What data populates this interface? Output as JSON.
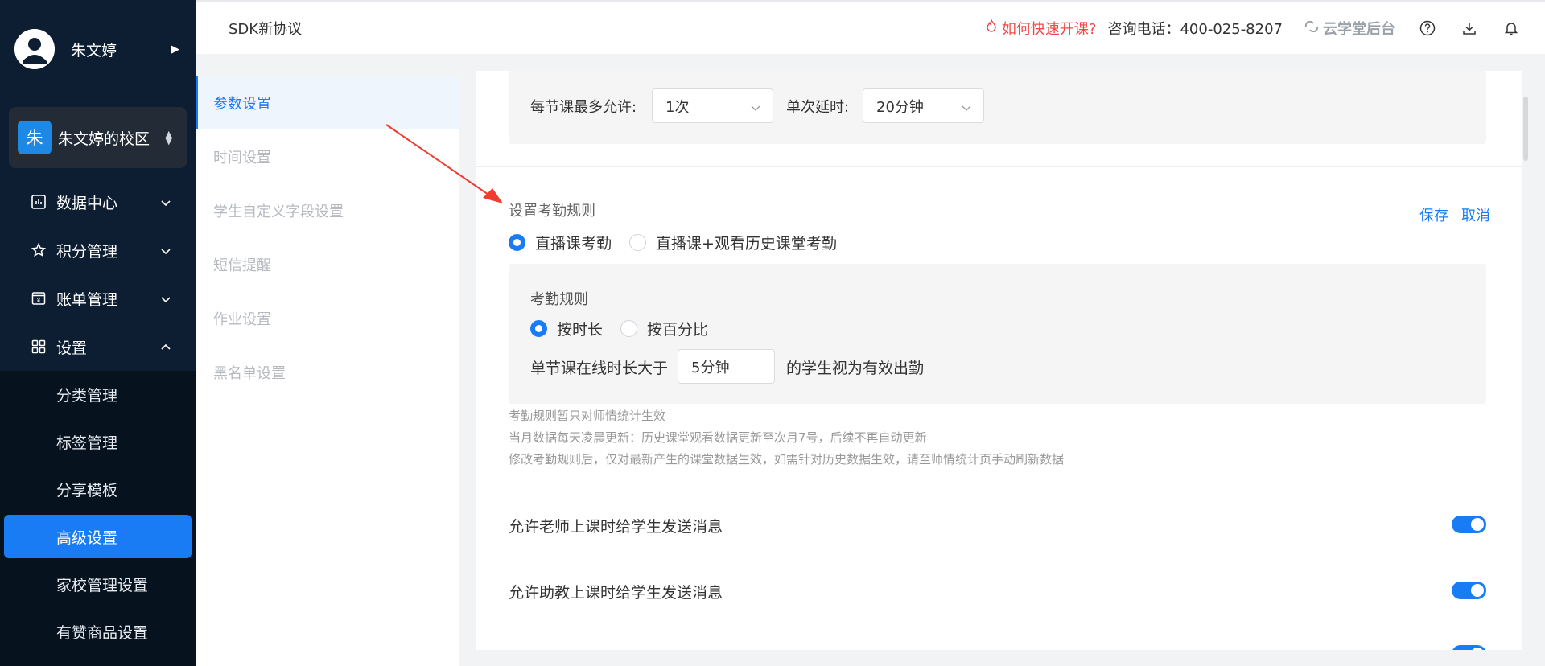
{
  "user": {
    "name": "朱文婷"
  },
  "campus": {
    "badge": "朱",
    "name": "朱文婷的校区"
  },
  "menu": [
    {
      "label": "数据中心",
      "icon": "chart-icon"
    },
    {
      "label": "积分管理",
      "icon": "star-icon"
    },
    {
      "label": "账单管理",
      "icon": "bill-icon"
    },
    {
      "label": "设置",
      "icon": "grid-icon"
    }
  ],
  "submenu": [
    {
      "label": "分类管理"
    },
    {
      "label": "标签管理"
    },
    {
      "label": "分享模板"
    },
    {
      "label": "高级设置",
      "active": true
    },
    {
      "label": "家校管理设置"
    },
    {
      "label": "有赞商品设置"
    }
  ],
  "header": {
    "title": "SDK新协议",
    "quick_start": "如何快速开课?",
    "phone": "咨询电话：400-025-8207",
    "backend": "云学堂后台"
  },
  "subnav": [
    {
      "label": "参数设置",
      "active": true
    },
    {
      "label": "时间设置"
    },
    {
      "label": "学生自定义字段设置"
    },
    {
      "label": "短信提醒"
    },
    {
      "label": "作业设置"
    },
    {
      "label": "黑名单设置"
    }
  ],
  "delay": {
    "max_label": "每节课最多允许:",
    "max_value": "1次",
    "single_label": "单次延时:",
    "single_value": "20分钟"
  },
  "attendance": {
    "title": "设置考勤规则",
    "save": "保存",
    "cancel": "取消",
    "mode_options": [
      "直播课考勤",
      "直播课+观看历史课堂考勤"
    ],
    "mode_selected": 0,
    "rule_title": "考勤规则",
    "rule_options": [
      "按时长",
      "按百分比"
    ],
    "rule_selected": 0,
    "duration_prefix": "单节课在线时长大于",
    "duration_value": "5分钟",
    "duration_suffix": "的学生视为有效出勤",
    "notes": [
      "考勤规则暂只对师情统计生效",
      "当月数据每天凌晨更新：历史课堂观看数据更新至次月7号，后续不再自动更新",
      "修改考勤规则后，仅对最新产生的课堂数据生效，如需针对历史数据生效，请至师情统计页手动刷新数据"
    ]
  },
  "toggles": [
    {
      "label": "允许老师上课时给学生发送消息",
      "on": true
    },
    {
      "label": "允许助教上课时给学生发送消息",
      "on": true
    }
  ],
  "colors": {
    "accent": "#1a7cf5",
    "sidebar": "#0d1e33",
    "danger": "#f04646"
  }
}
